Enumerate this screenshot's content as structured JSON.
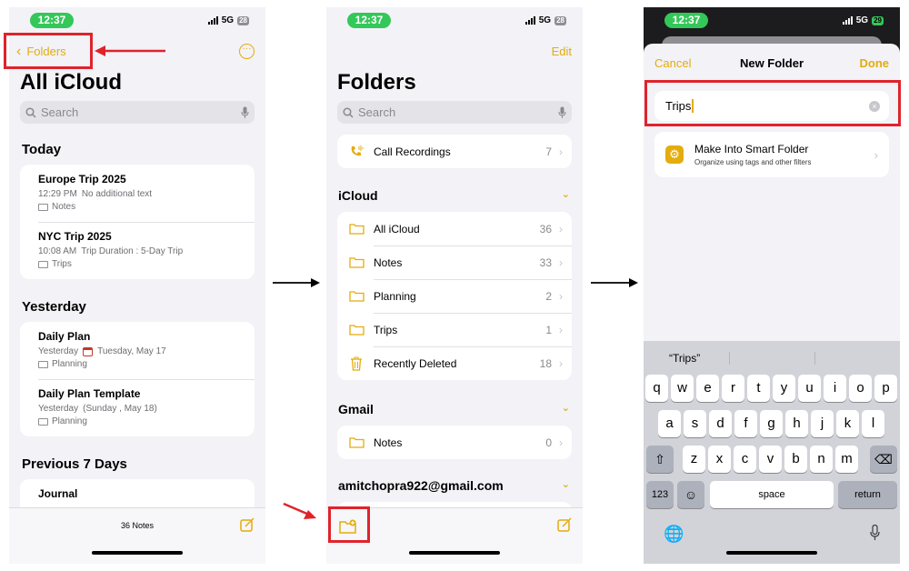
{
  "screen1": {
    "time": "12:37",
    "signal": "5G",
    "battery": "28",
    "back_label": "Folders",
    "title": "All iCloud",
    "search_placeholder": "Search",
    "sections": [
      {
        "header": "Today",
        "notes": [
          {
            "title": "Europe Trip 2025",
            "time": "12:29 PM",
            "preview": "No additional text",
            "folder": "Notes"
          },
          {
            "title": "NYC Trip 2025",
            "time": "10:08 AM",
            "preview": "Trip Duration : 5-Day Trip",
            "folder": "Trips"
          }
        ]
      },
      {
        "header": "Yesterday",
        "notes": [
          {
            "title": "Daily Plan",
            "time": "Yesterday",
            "preview": "Tuesday, May 17",
            "folder": "Planning"
          },
          {
            "title": "Daily Plan Template",
            "time": "Yesterday",
            "preview": "(Sunday , May 18)",
            "folder": "Planning"
          }
        ]
      },
      {
        "header": "Previous 7 Days",
        "notes": [
          {
            "title": "Journal"
          }
        ]
      }
    ],
    "notes_count": "36 Notes"
  },
  "screen2": {
    "time": "12:37",
    "signal": "5G",
    "battery": "28",
    "edit_label": "Edit",
    "title": "Folders",
    "search_placeholder": "Search",
    "call_recordings": {
      "label": "Call Recordings",
      "count": "7"
    },
    "icloud_header": "iCloud",
    "icloud_folders": [
      {
        "label": "All iCloud",
        "count": "36"
      },
      {
        "label": "Notes",
        "count": "33"
      },
      {
        "label": "Planning",
        "count": "2"
      },
      {
        "label": "Trips",
        "count": "1"
      },
      {
        "label": "Recently Deleted",
        "count": "18"
      }
    ],
    "gmail_header": "Gmail",
    "gmail_folders": [
      {
        "label": "Notes",
        "count": "0"
      }
    ],
    "account_header": "amitchopra922@gmail.com"
  },
  "screen3": {
    "time": "12:37",
    "signal": "5G",
    "battery": "29",
    "cancel_label": "Cancel",
    "title": "New Folder",
    "done_label": "Done",
    "folder_name_value": "Trips",
    "smart_folder_title": "Make Into Smart Folder",
    "smart_folder_subtitle": "Organize using tags and other filters",
    "suggestion": "“Trips”",
    "keyboard": {
      "row1": [
        "q",
        "w",
        "e",
        "r",
        "t",
        "y",
        "u",
        "i",
        "o",
        "p"
      ],
      "row2": [
        "a",
        "s",
        "d",
        "f",
        "g",
        "h",
        "j",
        "k",
        "l"
      ],
      "row3": [
        "z",
        "x",
        "c",
        "v",
        "b",
        "n",
        "m"
      ],
      "numbers_key": "123",
      "space_key": "space",
      "return_key": "return"
    }
  },
  "colors": {
    "accent": "#e4ac0c",
    "highlight": "#e0232b",
    "status_green": "#34c759"
  }
}
